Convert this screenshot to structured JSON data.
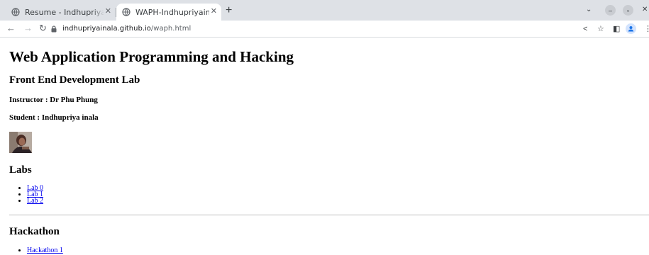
{
  "browser": {
    "tabs": [
      {
        "title": "Resume - Indhupriya inala"
      },
      {
        "title": "WAPH-Indhupriyainala"
      }
    ],
    "address": {
      "host": "indhupriyainala.github.io",
      "path": "/waph.html"
    }
  },
  "page": {
    "title": "Web Application Programming and Hacking",
    "subtitle": "Front End Development Lab",
    "instructor": "Instructor : Dr Phu Phung",
    "student": "Student : Indhupriya inala",
    "labs_heading": "Labs",
    "labs": [
      "Lab 0",
      "Lab 1",
      "Lab 2"
    ],
    "hackathon_heading": "Hackathon",
    "hackathons": [
      "Hackathon 1"
    ]
  },
  "colors": {
    "link": "#0000ee",
    "tabbar": "#dee1e6"
  }
}
